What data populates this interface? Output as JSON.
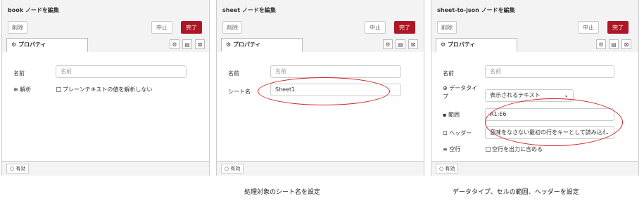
{
  "panels": [
    {
      "title": "book ノードを編集",
      "delete_label": "削除",
      "cancel_label": "中止",
      "done_label": "完了",
      "tab_label": "⚙ プロパティ",
      "name_label": "名前",
      "name_placeholder": "名前",
      "parse_label": "⊕ 解析",
      "parse_checkbox_label": "プレーンテキストの値を解析しない",
      "enabled_label": "○ 有効"
    },
    {
      "title": "sheet ノードを編集",
      "delete_label": "削除",
      "cancel_label": "中止",
      "done_label": "完了",
      "tab_label": "⚙ プロパティ",
      "name_label": "名前",
      "name_placeholder": "名前",
      "sheet_name_label": "シート名",
      "sheet_name_value": "Sheet1",
      "enabled_label": "○ 有効"
    },
    {
      "title": "sheet-to-json ノードを編集",
      "delete_label": "削除",
      "cancel_label": "中止",
      "done_label": "完了",
      "tab_label": "⚙ プロパティ",
      "name_label": "名前",
      "name_placeholder": "名前",
      "datatype_label_line1": "⊕ データタイ",
      "datatype_label_line2": "プ",
      "datatype_value": "表示されるテキスト",
      "range_label": "▪ 範囲",
      "range_value": "A1:E6",
      "header_label": "⊡ ヘッダー",
      "header_value": "意味をなさない最初の行をキーとして読み込む",
      "blank_label": "≡ 空行",
      "blank_checkbox_label": "空行を出力に含める",
      "enabled_label": "○ 有効"
    }
  ],
  "captions": {
    "sheet": "処理対象のシート名を設定",
    "json": "データタイプ、セルの範囲、ヘッダーを設定"
  },
  "colors": {
    "done_button": "#ad1625",
    "annotation_ellipse": "#d42020"
  }
}
